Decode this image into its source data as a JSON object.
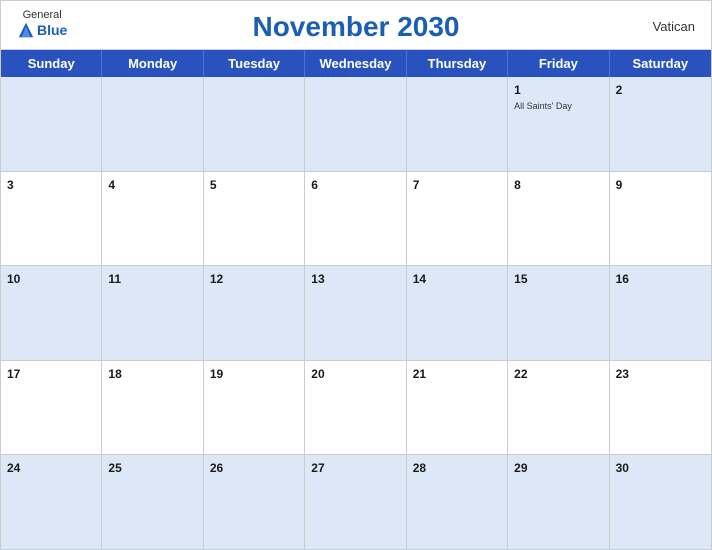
{
  "header": {
    "title": "November 2030",
    "country": "Vatican",
    "logo_general": "General",
    "logo_blue": "Blue"
  },
  "dayHeaders": [
    "Sunday",
    "Monday",
    "Tuesday",
    "Wednesday",
    "Thursday",
    "Friday",
    "Saturday"
  ],
  "weeks": [
    [
      {
        "day": "",
        "holiday": ""
      },
      {
        "day": "",
        "holiday": ""
      },
      {
        "day": "",
        "holiday": ""
      },
      {
        "day": "",
        "holiday": ""
      },
      {
        "day": "",
        "holiday": ""
      },
      {
        "day": "1",
        "holiday": "All Saints' Day"
      },
      {
        "day": "2",
        "holiday": ""
      }
    ],
    [
      {
        "day": "3",
        "holiday": ""
      },
      {
        "day": "4",
        "holiday": ""
      },
      {
        "day": "5",
        "holiday": ""
      },
      {
        "day": "6",
        "holiday": ""
      },
      {
        "day": "7",
        "holiday": ""
      },
      {
        "day": "8",
        "holiday": ""
      },
      {
        "day": "9",
        "holiday": ""
      }
    ],
    [
      {
        "day": "10",
        "holiday": ""
      },
      {
        "day": "11",
        "holiday": ""
      },
      {
        "day": "12",
        "holiday": ""
      },
      {
        "day": "13",
        "holiday": ""
      },
      {
        "day": "14",
        "holiday": ""
      },
      {
        "day": "15",
        "holiday": ""
      },
      {
        "day": "16",
        "holiday": ""
      }
    ],
    [
      {
        "day": "17",
        "holiday": ""
      },
      {
        "day": "18",
        "holiday": ""
      },
      {
        "day": "19",
        "holiday": ""
      },
      {
        "day": "20",
        "holiday": ""
      },
      {
        "day": "21",
        "holiday": ""
      },
      {
        "day": "22",
        "holiday": ""
      },
      {
        "day": "23",
        "holiday": ""
      }
    ],
    [
      {
        "day": "24",
        "holiday": ""
      },
      {
        "day": "25",
        "holiday": ""
      },
      {
        "day": "26",
        "holiday": ""
      },
      {
        "day": "27",
        "holiday": ""
      },
      {
        "day": "28",
        "holiday": ""
      },
      {
        "day": "29",
        "holiday": ""
      },
      {
        "day": "30",
        "holiday": ""
      }
    ]
  ]
}
